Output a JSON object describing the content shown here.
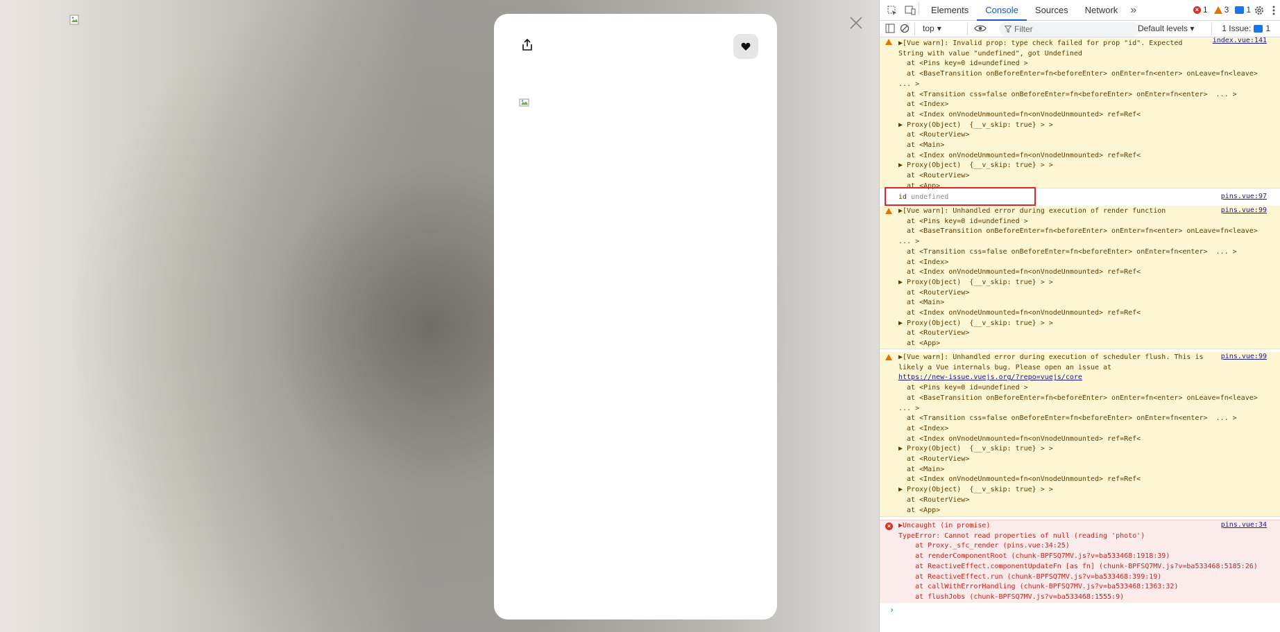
{
  "modal": {
    "share_icon": "share-icon",
    "like_icon": "heart-icon",
    "close_icon": "close-icon"
  },
  "devtools": {
    "tabs": [
      "Elements",
      "Console",
      "Sources",
      "Network"
    ],
    "active_tab": "Console",
    "counters": {
      "errors": "1",
      "warnings": "3",
      "messages": "1"
    },
    "toolbar": {
      "context": "top",
      "filter_placeholder": "Filter",
      "levels": "Default levels",
      "issues": "1 Issue:",
      "issues_count": "1"
    },
    "console": {
      "warn1": {
        "lines": [
          "▶[Vue warn]: Invalid prop: type check failed for prop \"id\". Expected",
          "String with value \"undefined\", got Undefined",
          "  at <Pins key=0 id=undefined >",
          "  at <BaseTransition onBeforeEnter=fn<beforeEnter> onEnter=fn<enter> onLeave=fn<leave>",
          "... >",
          "  at <Transition css=false onBeforeEnter=fn<beforeEnter> onEnter=fn<enter>  ... >",
          "  at <Index>",
          "  at <Index onVnodeUnmounted=fn<onVnodeUnmounted> ref=Ref<",
          "▶ Proxy(Object)  {__v_skip: true} > >",
          "  at <RouterView>",
          "  at <Main>",
          "  at <Index onVnodeUnmounted=fn<onVnodeUnmounted> ref=Ref<",
          "▶ Proxy(Object)  {__v_skip: true} > >",
          "  at <RouterView>",
          "  at <App>"
        ],
        "source": "index.vue:141"
      },
      "log_id": {
        "label": "id",
        "value": "undefined",
        "source": "pins.vue:97"
      },
      "warn2": {
        "lines": [
          "▶[Vue warn]: Unhandled error during execution of render function",
          "  at <Pins key=0 id=undefined >",
          "  at <BaseTransition onBeforeEnter=fn<beforeEnter> onEnter=fn<enter> onLeave=fn<leave>",
          "... >",
          "  at <Transition css=false onBeforeEnter=fn<beforeEnter> onEnter=fn<enter>  ... >",
          "  at <Index>",
          "  at <Index onVnodeUnmounted=fn<onVnodeUnmounted> ref=Ref<",
          "▶ Proxy(Object)  {__v_skip: true} > >",
          "  at <RouterView>",
          "  at <Main>",
          "  at <Index onVnodeUnmounted=fn<onVnodeUnmounted> ref=Ref<",
          "▶ Proxy(Object)  {__v_skip: true} > >",
          "  at <RouterView>",
          "  at <App>"
        ],
        "source": "pins.vue:99"
      },
      "warn3": {
        "lines": [
          "▶[Vue warn]: Unhandled error during execution of scheduler flush. This is",
          "likely a Vue internals bug. Please open an issue at",
          "https://new-issue.vuejs.org/?repo=vuejs/core",
          "  at <Pins key=0 id=undefined >",
          "  at <BaseTransition onBeforeEnter=fn<beforeEnter> onEnter=fn<enter> onLeave=fn<leave>",
          "... >",
          "  at <Transition css=false onBeforeEnter=fn<beforeEnter> onEnter=fn<enter>  ... >",
          "  at <Index>",
          "  at <Index onVnodeUnmounted=fn<onVnodeUnmounted> ref=Ref<",
          "▶ Proxy(Object)  {__v_skip: true} > >",
          "  at <RouterView>",
          "  at <Main>",
          "  at <Index onVnodeUnmounted=fn<onVnodeUnmounted> ref=Ref<",
          "▶ Proxy(Object)  {__v_skip: true} > >",
          "  at <RouterView>",
          "  at <App>"
        ],
        "source": "pins.vue:99"
      },
      "error": {
        "lines": [
          "▶Uncaught (in promise)",
          "TypeError: Cannot read properties of null (reading 'photo')",
          "    at Proxy._sfc_render (pins.vue:34:25)",
          "    at renderComponentRoot (chunk-BPFSQ7MV.js?v=ba533468:1918:39)",
          "    at ReactiveEffect.componentUpdateFn [as fn] (chunk-BPFSQ7MV.js?v=ba533468:5185:26)",
          "    at ReactiveEffect.run (chunk-BPFSQ7MV.js?v=ba533468:399:19)",
          "    at callWithErrorHandling (chunk-BPFSQ7MV.js?v=ba533468:1363:32)",
          "    at flushJobs (chunk-BPFSQ7MV.js?v=ba533468:1555:9)"
        ],
        "source": "pins.vue:34"
      },
      "prompt": "›"
    }
  }
}
